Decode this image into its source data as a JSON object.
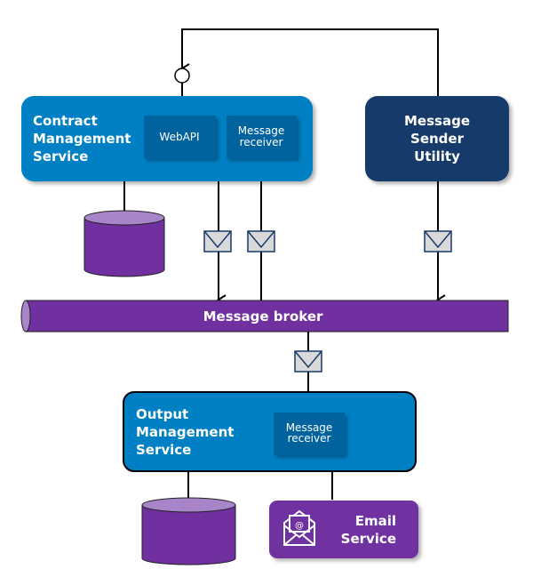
{
  "contract_service": {
    "line1": "Contract",
    "line2": "Management",
    "line3": "Service",
    "webapi": "WebAPI",
    "receiver_line1": "Message",
    "receiver_line2": "receiver"
  },
  "sender_utility": {
    "line1": "Message",
    "line2": "Sender",
    "line3": "Utility"
  },
  "broker": {
    "label": "Message broker"
  },
  "output_service": {
    "line1": "Output",
    "line2": "Management",
    "line3": "Service",
    "receiver_line1": "Message",
    "receiver_line2": "receiver"
  },
  "email_service": {
    "line1": "Email",
    "line2": "Service",
    "icon": "email-open-icon"
  },
  "colors": {
    "service_blue": "#0080c4",
    "inner_blue": "#00639e",
    "sender_navy": "#173a6a",
    "purple": "#7030a0",
    "purple_light": "#a884c8",
    "envelope": "#d9d9d9"
  }
}
